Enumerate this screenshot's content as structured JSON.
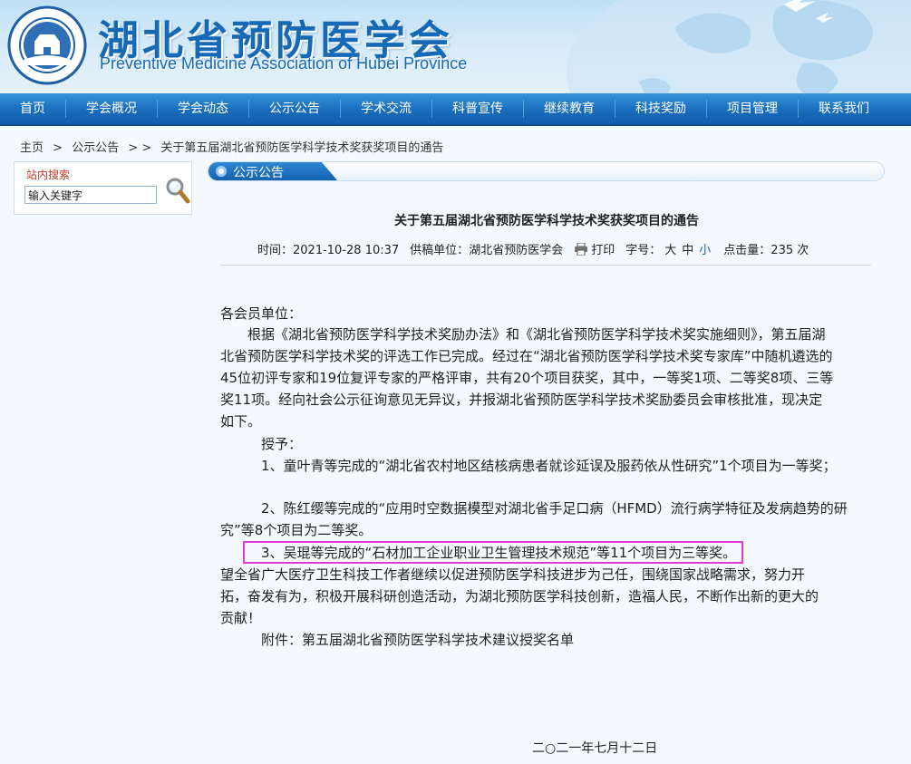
{
  "header": {
    "title_cn": "湖北省预防医学会",
    "title_en": "Preventive Medicine Association of Hubei Province",
    "logo_text": "Preventive Medicine Association of Hubei Province"
  },
  "nav": {
    "items": [
      "首页",
      "学会概况",
      "学会动态",
      "公示公告",
      "学术交流",
      "科普宣传",
      "继续教育",
      "科技奖励",
      "项目管理",
      "联系我们"
    ]
  },
  "breadcrumb": {
    "home": "主页",
    "sep1": ">",
    "section": "公示公告",
    "sep2": "> >",
    "current": "关于第五届湖北省预防医学科学技术奖获奖项目的通告"
  },
  "search": {
    "title": "站内搜索",
    "value": "输入关键字"
  },
  "section": {
    "label": "公示公告"
  },
  "article": {
    "title": "关于第五届湖北省预防医学科学技术奖获奖项目的通告",
    "meta": {
      "time_label": "时间：",
      "time_value": "2021-10-28 10:37",
      "source_label": "供稿单位：",
      "source_value": "湖北省预防医学会",
      "print_label": "打印",
      "font_label": "字号：",
      "font_large": "大",
      "font_medium": "中",
      "font_small": "小",
      "hits_label": "点击量：",
      "hits_value": "235",
      "hits_unit": "次"
    },
    "lines": [
      "各会员单位：",
      "　　根据《湖北省预防医学科学技术奖励办法》和《湖北省预防医学科学技术奖实施细则》，第五届湖",
      "北省预防医学科学技术奖的评选工作已完成。经过在“湖北省预防医学科学技术奖专家库”中随机遴选的",
      "45位初评专家和19位复评专家的严格评审，共有20个项目获奖，其中，一等奖1项、二等奖8项、三等",
      "奖11项。经向社会公示征询意见无异议，并报湖北省预防医学科学技术奖励委员会审核批准，现决定",
      "如下。",
      "　　　授予：",
      "　　　1、童叶青等完成的“湖北省农村地区结核病患者就诊延误及服药依从性研究”1个项目为一等奖；",
      "",
      "　　　2、陈红缨等完成的“应用时空数据模型对湖北省手足口病（HFMD）流行病学特征及发病趋势的研",
      "究”等8个项目为二等奖。",
      "　　　3、吴琨等完成的“石材加工企业职业卫生管理技术规范”等11个项目为三等奖。",
      "望全省广大医疗卫生科技工作者继续以促进预防医学科技进步为己任，围绕国家战略需求，努力开",
      "拓，奋发有为，积极开展科研创造活动，为湖北预防医学科技创新，造福人民，不断作出新的更大的",
      "贡献！",
      "　　　附件：第五届湖北省预防医学科学技术建议授奖名单"
    ],
    "date": "二○二一年七月十二日"
  },
  "colors": {
    "brand_blue": "#1669b4",
    "nav_blue": "#1a6fbf",
    "highlight": "#e03bd8"
  }
}
